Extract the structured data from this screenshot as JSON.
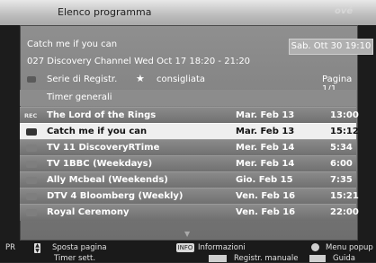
{
  "header": {
    "title": "Elenco programma",
    "logo": "ové"
  },
  "current": {
    "title": "Catch me if you can",
    "details": "027 Discovery Channel Wed Oct 17    18:20 - 21:20",
    "datetime": "Sab. Ott  30  19:10"
  },
  "legend": {
    "series_label": "Serie di Registr.",
    "star_label": "consigliata",
    "page": "Pagina 1/1"
  },
  "section_title": "Timer generali",
  "rows": [
    {
      "icon": "REC",
      "name": "The Lord of the Rings",
      "date": "Mar. Feb 13",
      "time": "13:00"
    },
    {
      "icon": "",
      "name": "Catch me if you can",
      "date": "Mar. Feb 13",
      "time": "15:12"
    },
    {
      "icon": "",
      "name": "TV  11 DiscoveryRTime",
      "date": "Mer. Feb 14",
      "time": "5:34"
    },
    {
      "icon": "",
      "name": "TV  1BBC (Weekdays)",
      "date": "Mer. Feb 14",
      "time": "6:00"
    },
    {
      "icon": "",
      "name": "Ally Mcbeal (Weekends)",
      "date": "Gio. Feb 15",
      "time": "7:35"
    },
    {
      "icon": "",
      "name": "DTV 4 Bloomberg (Weekly)",
      "date": "Ven. Feb 16",
      "time": "15:21"
    },
    {
      "icon": "",
      "name": "Royal Ceremony",
      "date": "Ven. Feb 16",
      "time": "22:00"
    }
  ],
  "footer": {
    "pr_label": "PR",
    "move_page": "Sposta pagina",
    "info_key": "INFO",
    "info_label": "Informazioni",
    "popup_label": "Menu popup",
    "timer_label": "Timer sett.",
    "manual_label": "Registr. manuale",
    "guide_label": "Guida"
  }
}
